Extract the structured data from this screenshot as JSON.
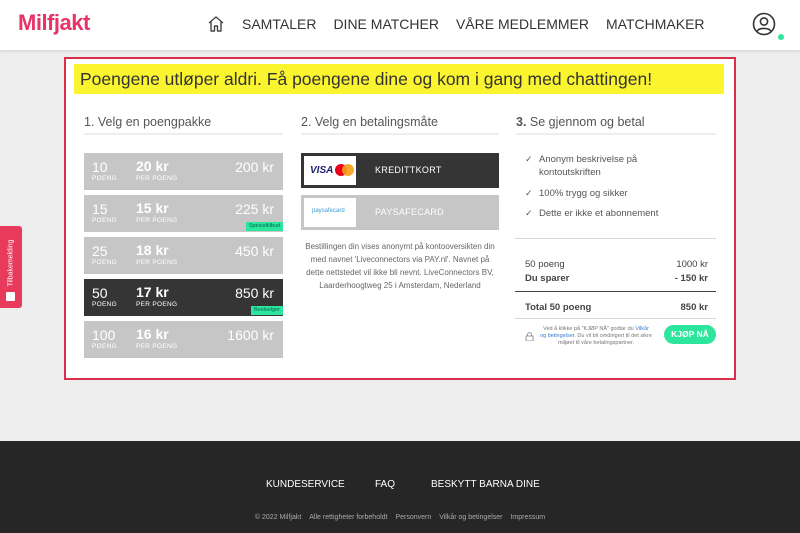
{
  "header": {
    "logo": "Milfjakt",
    "nav": [
      "SAMTALER",
      "DINE MATCHER",
      "VÅRE MEDLEMMER",
      "MATCHMAKER"
    ],
    "icons": {
      "home": "home-icon",
      "profile": "user-circle-icon"
    }
  },
  "banner": "Poengene utløper aldri. Få poengene dine og kom i gang med chattingen!",
  "step1": {
    "title": "1. Velg en poengpakke",
    "packages": [
      {
        "points": "10",
        "points_unit": "POENG",
        "per": "20 kr",
        "per_unit": "PER POENG",
        "total": "200 kr"
      },
      {
        "points": "15",
        "points_unit": "POENG",
        "per": "15 kr",
        "per_unit": "PER POENG",
        "total": "225 kr",
        "badge": "Spesialtilbud"
      },
      {
        "points": "25",
        "points_unit": "POENG",
        "per": "18 kr",
        "per_unit": "PER POENG",
        "total": "450 kr"
      },
      {
        "points": "50",
        "points_unit": "POENG",
        "per": "17 kr",
        "per_unit": "PER POENG",
        "total": "850 kr",
        "badge": "Bestselger"
      },
      {
        "points": "100",
        "points_unit": "POENG",
        "per": "16 kr",
        "per_unit": "PER POENG",
        "total": "1600 kr"
      }
    ]
  },
  "step2": {
    "title": "2. Velg en betalingsmåte",
    "methods": [
      {
        "label": "KREDITTKORT",
        "logo": "VISA"
      },
      {
        "label": "PAYSAFECARD",
        "logo": "paysafecard"
      }
    ],
    "note": "Bestillingen din vises anonymt på kontooversikten din med navnet 'Liveconnectors via PAY.nl'. Navnet på dette nettstedet vil ikke bli nevnt. LiveConnectors BV, Laarderhoogtweg 25 i Amsterdam, Nederland"
  },
  "step3": {
    "title_num": "3.",
    "title_text": "Se gjennom og betal",
    "features": [
      "Anonym beskrivelse på kontoutskriften",
      "100% trygg og sikker",
      "Dette er ikke et abonnement"
    ],
    "rows": [
      {
        "label": "50 poeng",
        "value": "1000 kr"
      },
      {
        "label": "Du sparer",
        "value": "- 150 kr"
      }
    ],
    "total": {
      "label": "Total 50 poeng",
      "value": "850 kr"
    },
    "terms_before": "Ved å klikke på \"KJØP NÅ\" godtar du",
    "terms_link": "Vilkår og betingelser",
    "terms_after": ". Du vil bli omdirigert til det sikre miljøet til våre betalingspartner.",
    "buy_label": "KJØP NÅ"
  },
  "side_tab": "Tilbakemelding",
  "footer": {
    "links": [
      "KUNDESERVICE",
      "FAQ",
      "BESKYTT BARNA DINE"
    ],
    "bottom": [
      "© 2022 Milfjakt",
      "Alle rettigheter forbeholdt",
      "Personvern",
      "Vilkår og betingelser",
      "Impressum"
    ]
  },
  "colors": {
    "brand": "#e8336a",
    "accent": "#2ee59d",
    "banner": "#fbf52f",
    "frame": "#d8304a",
    "selected": "#353535"
  }
}
